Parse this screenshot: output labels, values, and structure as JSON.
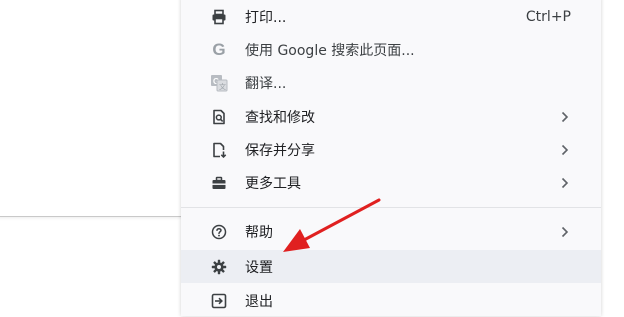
{
  "menu": {
    "items": [
      {
        "label": "打印...",
        "shortcut": "Ctrl+P",
        "icon": "printer-icon"
      },
      {
        "label": "使用 Google 搜索此页面...",
        "icon": "google-g-icon"
      },
      {
        "label": "翻译...",
        "icon": "translate-icon"
      },
      {
        "label": "查找和修改",
        "icon": "find-page-icon"
      },
      {
        "label": "保存并分享",
        "icon": "save-share-icon"
      },
      {
        "label": "更多工具",
        "icon": "toolbox-icon"
      },
      {
        "label": "帮助",
        "icon": "help-icon"
      },
      {
        "label": "设置",
        "icon": "gear-icon"
      },
      {
        "label": "退出",
        "icon": "exit-icon"
      }
    ]
  },
  "colors": {
    "menu_background": "#f9f9fb",
    "hover_background": "#eceef3",
    "icon": "#3c4043",
    "annotation_arrow": "#e02020"
  }
}
